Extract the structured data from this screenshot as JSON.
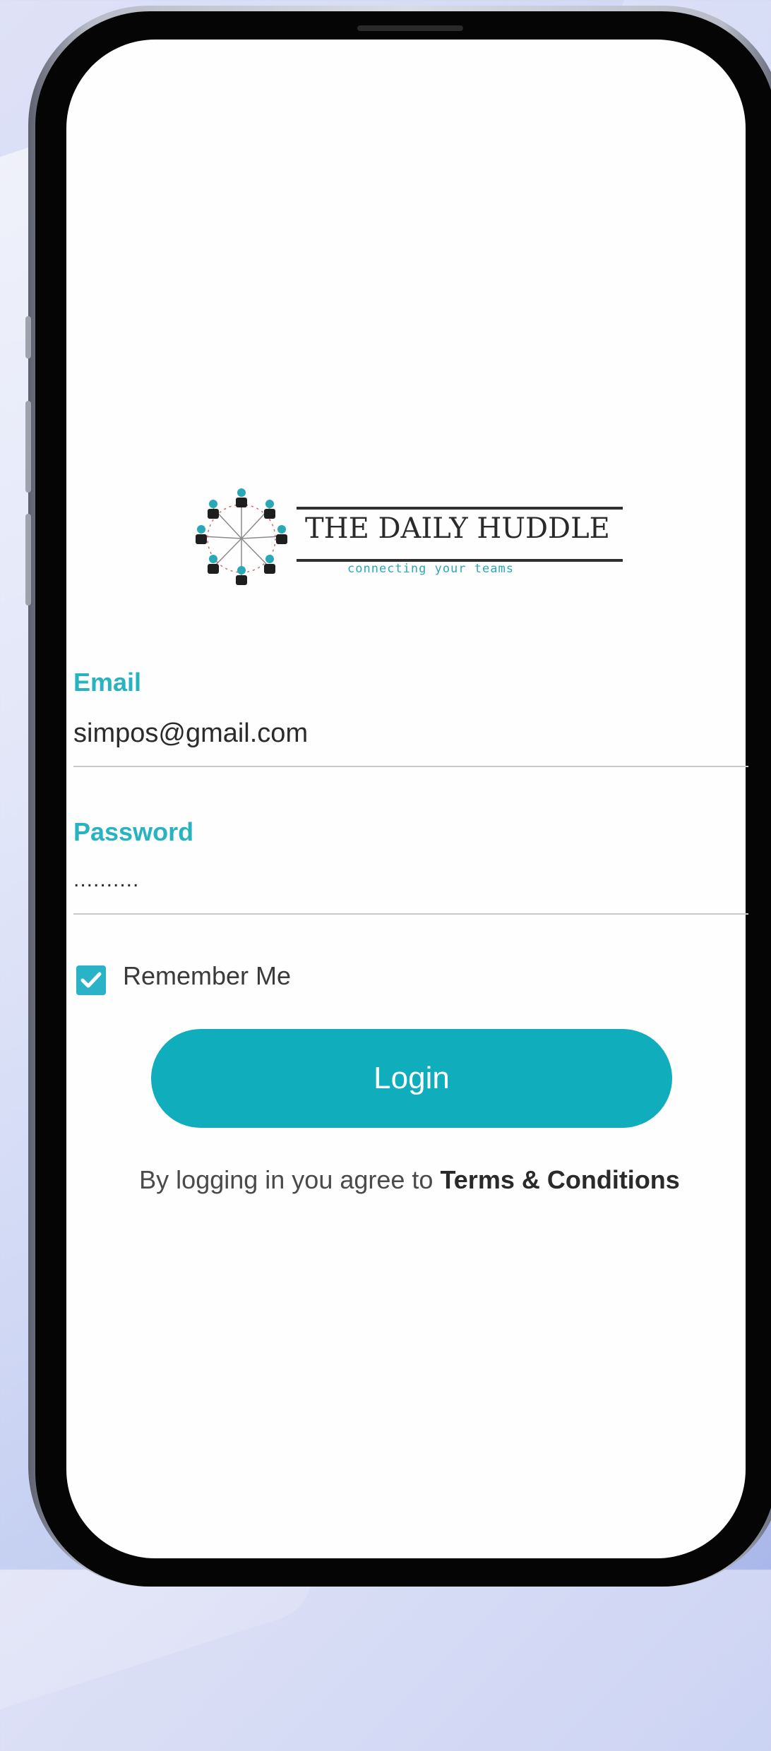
{
  "logo": {
    "title": "THE DAILY HUDDLE",
    "tagline": "connecting your teams"
  },
  "form": {
    "email_label": "Email",
    "email_value": "simpos@gmail.com",
    "password_label": "Password",
    "password_value": "..........",
    "remember_label": "Remember Me",
    "remember_checked": true,
    "login_label": "Login"
  },
  "terms": {
    "prefix": "By logging in you agree to",
    "link": "Terms & Conditions"
  },
  "colors": {
    "accent": "#10aebd",
    "label": "#29b3c1"
  }
}
